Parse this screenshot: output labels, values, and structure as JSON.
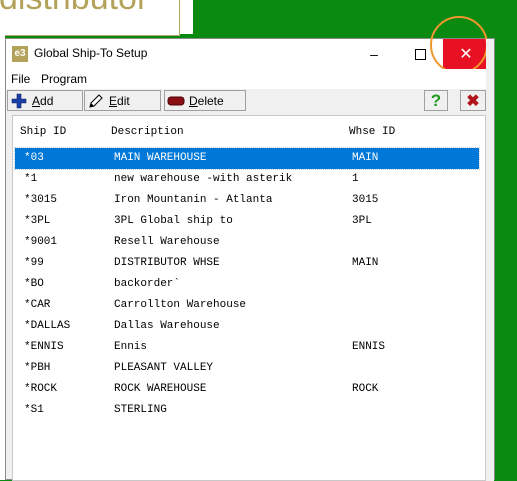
{
  "background": {
    "header_text": "distributor",
    "color": "#0b8a12"
  },
  "window": {
    "title": "Global Ship-To Setup",
    "icon_text": "e3",
    "controls": {
      "minimize": "–",
      "close": "✕"
    }
  },
  "menu": [
    "File",
    "Program"
  ],
  "toolbar": {
    "add": {
      "accel": "A",
      "rest": "dd"
    },
    "edit": {
      "accel": "E",
      "rest": "dit"
    },
    "delete": {
      "accel": "D",
      "rest": "elete"
    },
    "help": "?",
    "exit": "✖"
  },
  "table": {
    "headers": [
      "Ship ID",
      "Description",
      "Whse ID"
    ],
    "rows": [
      {
        "ship_id": "*03",
        "description": "MAIN WAREHOUSE",
        "whse_id": "MAIN",
        "selected": true
      },
      {
        "ship_id": "*1",
        "description": "new warehouse -with asterik",
        "whse_id": "1"
      },
      {
        "ship_id": "*3015",
        "description": "Iron Mountanin - Atlanta",
        "whse_id": "3015"
      },
      {
        "ship_id": "*3PL",
        "description": "3PL Global ship to",
        "whse_id": "3PL"
      },
      {
        "ship_id": "*9001",
        "description": "Resell Warehouse",
        "whse_id": ""
      },
      {
        "ship_id": "*99",
        "description": "DISTRIBUTOR WHSE",
        "whse_id": "MAIN"
      },
      {
        "ship_id": "*BO",
        "description": "backorder`",
        "whse_id": ""
      },
      {
        "ship_id": "*CAR",
        "description": "Carrollton Warehouse",
        "whse_id": ""
      },
      {
        "ship_id": "*DALLAS",
        "description": "Dallas Warehouse",
        "whse_id": ""
      },
      {
        "ship_id": "*ENNIS",
        "description": "Ennis",
        "whse_id": "ENNIS"
      },
      {
        "ship_id": "*PBH",
        "description": "PLEASANT VALLEY",
        "whse_id": ""
      },
      {
        "ship_id": "*ROCK",
        "description": "ROCK WAREHOUSE",
        "whse_id": "ROCK"
      },
      {
        "ship_id": "*S1",
        "description": "STERLING",
        "whse_id": ""
      }
    ]
  },
  "colors": {
    "selection": "#0078d7",
    "close_button": "#e81123",
    "highlight_ring": "#f0962e",
    "help_icon": "#1e9b1e",
    "exit_icon": "#b0161b"
  }
}
